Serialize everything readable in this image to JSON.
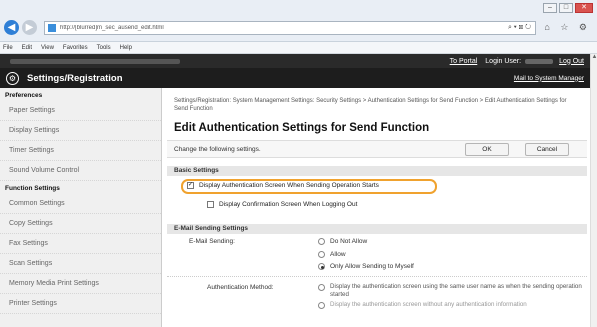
{
  "browser": {
    "url": "http://[blurred]m_sec_ausend_edit.html",
    "address_tools": "⌕ ▾ ⊠ ↻",
    "right_icons": "⌂ ☆ ⚙"
  },
  "menubar": [
    "File",
    "Edit",
    "View",
    "Favorites",
    "Tools",
    "Help"
  ],
  "topbar": {
    "portal": "To Portal",
    "login_label": "Login User:",
    "logout": "Log Out"
  },
  "header": {
    "title": "Settings/Registration",
    "mail": "Mail to System Manager"
  },
  "sidebar": {
    "preferences_heading": "Preferences",
    "preferences": [
      "Paper Settings",
      "Display Settings",
      "Timer Settings",
      "Sound Volume Control"
    ],
    "function_heading": "Function Settings",
    "functions": [
      "Common Settings",
      "Copy Settings",
      "Fax Settings",
      "Scan Settings",
      "Memory Media Print Settings",
      "Printer Settings"
    ]
  },
  "main": {
    "breadcrumb": "Settings/Registration: System Management Settings: Security Settings > Authentication Settings for Send Function > Edit Authentication Settings for Send Function",
    "title": "Edit Authentication Settings for Send Function",
    "change_text": "Change the following settings.",
    "ok": "OK",
    "cancel": "Cancel",
    "basic_heading": "Basic Settings",
    "basic_options": [
      {
        "label": "Display Authentication Screen When Sending Operation Starts",
        "checked": true
      },
      {
        "label": "Display Confirmation Screen When Logging Out",
        "checked": false
      }
    ],
    "email_heading": "E-Mail Sending Settings",
    "email_sending_label": "E-Mail Sending:",
    "email_options": [
      {
        "label": "Do Not Allow",
        "selected": false
      },
      {
        "label": "Allow",
        "selected": false
      },
      {
        "label": "Only Allow Sending to Myself",
        "selected": true
      }
    ],
    "auth_method_label": "Authentication Method:",
    "auth_option_1": "Display the authentication screen using the same user name as when the sending operation started",
    "auth_option_2": "Display the authentication screen without any authentication information"
  }
}
